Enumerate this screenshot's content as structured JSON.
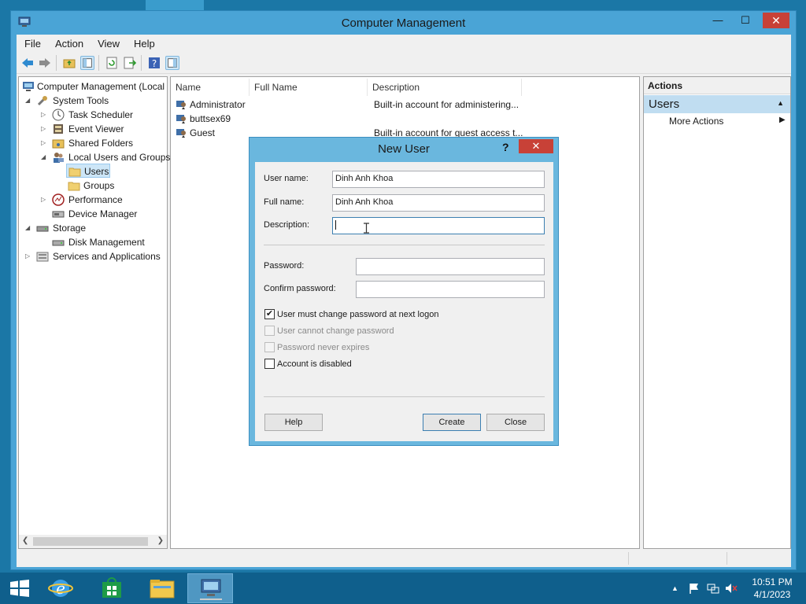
{
  "window": {
    "title": "Computer Management",
    "minimize": "—",
    "maximize": "☐",
    "close": "✕"
  },
  "menu": [
    "File",
    "Action",
    "View",
    "Help"
  ],
  "tree": {
    "items": [
      {
        "label": "Computer Management (Local",
        "icon": "computer-icon"
      },
      {
        "label": "System Tools",
        "icon": "tools-icon"
      },
      {
        "label": "Task Scheduler",
        "icon": "clock-icon"
      },
      {
        "label": "Event Viewer",
        "icon": "event-viewer-icon"
      },
      {
        "label": "Shared Folders",
        "icon": "shared-folder-icon"
      },
      {
        "label": "Local Users and Groups",
        "icon": "users-icon"
      },
      {
        "label": "Users",
        "icon": "folder-icon"
      },
      {
        "label": "Groups",
        "icon": "folder-icon"
      },
      {
        "label": "Performance",
        "icon": "performance-icon"
      },
      {
        "label": "Device Manager",
        "icon": "device-manager-icon"
      },
      {
        "label": "Storage",
        "icon": "storage-icon"
      },
      {
        "label": "Disk Management",
        "icon": "disk-icon"
      },
      {
        "label": "Services and Applications",
        "icon": "services-icon"
      }
    ]
  },
  "list": {
    "columns": [
      "Name",
      "Full Name",
      "Description"
    ],
    "rows": [
      {
        "name": "Administrator",
        "full_name": "",
        "description": "Built-in account for administering..."
      },
      {
        "name": "buttsex69",
        "full_name": "",
        "description": ""
      },
      {
        "name": "Guest",
        "full_name": "",
        "description": "Built-in account for guest access t..."
      }
    ]
  },
  "actions": {
    "header": "Actions",
    "section": "Users",
    "item": "More Actions"
  },
  "dialog": {
    "title": "New User",
    "help_glyph": "?",
    "close_glyph": "✕",
    "username_label": "User name:",
    "username_value": "Dinh Anh Khoa",
    "fullname_label": "Full name:",
    "fullname_value": "Dinh Anh Khoa",
    "description_label": "Description:",
    "description_value": "",
    "password_label": "Password:",
    "confirm_label": "Confirm password:",
    "checkboxes": [
      {
        "label": "User must change password at next logon",
        "checked": true,
        "enabled": true
      },
      {
        "label": "User cannot change password",
        "checked": false,
        "enabled": false
      },
      {
        "label": "Password never expires",
        "checked": false,
        "enabled": false
      },
      {
        "label": "Account is disabled",
        "checked": false,
        "enabled": true
      }
    ],
    "help_button": "Help",
    "create_button": "Create",
    "close_button": "Close"
  },
  "taskbar": {
    "time": "10:51 PM",
    "date": "4/1/2023"
  },
  "colors": {
    "accent": "#4aa4d6",
    "selection": "#cde6f7",
    "close": "#c84137",
    "taskbar": "#0f5f8c"
  }
}
